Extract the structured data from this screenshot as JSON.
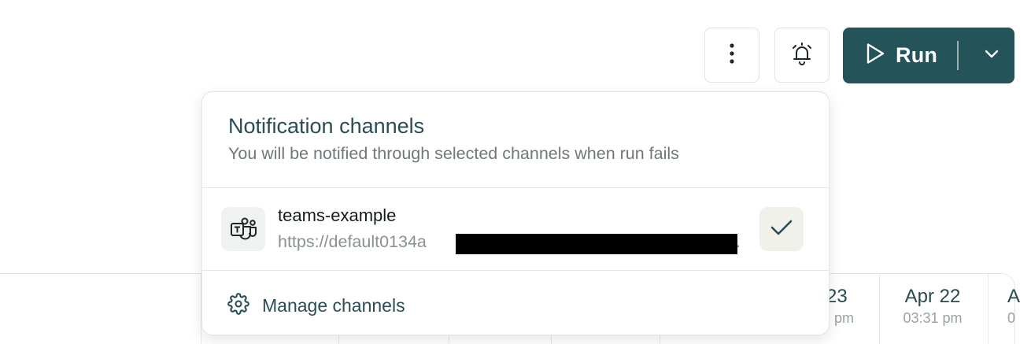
{
  "toolbar": {
    "more_icon": "vertical-ellipsis",
    "alerts_icon": "alarm-bell",
    "run_label": "Run",
    "run_icon": "play",
    "run_caret_icon": "chevron-down",
    "accent": "#24535a"
  },
  "table": {
    "dates": [
      {
        "date": "23",
        "time": "pm"
      },
      {
        "date": "Apr 22",
        "time": "03:31 pm"
      },
      {
        "date": "A",
        "time": "0"
      }
    ]
  },
  "popover": {
    "title": "Notification channels",
    "subtitle": "You will be notified through selected channels when run fails",
    "channels": [
      {
        "icon": "teams-icon",
        "name": "teams-example",
        "url_prefix": "https://default0134a",
        "url_suffix": ".",
        "checked": true
      }
    ],
    "manage_label": "Manage channels",
    "manage_icon": "gear"
  }
}
